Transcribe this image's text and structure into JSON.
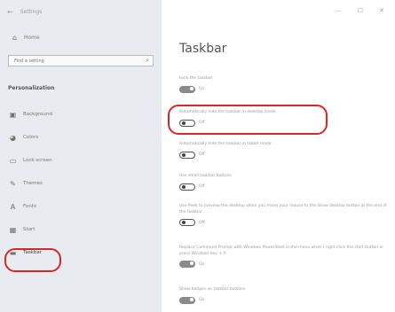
{
  "app": {
    "title": "Settings",
    "back_glyph": "←"
  },
  "sidebar": {
    "home_label": "Home",
    "search_placeholder": "Find a setting",
    "section": "Personalization",
    "items": [
      {
        "label": "Background",
        "icon": "picture-icon"
      },
      {
        "label": "Colors",
        "icon": "palette-icon"
      },
      {
        "label": "Lock screen",
        "icon": "lock-screen-icon"
      },
      {
        "label": "Themes",
        "icon": "brush-icon"
      },
      {
        "label": "Fonts",
        "icon": "font-icon"
      },
      {
        "label": "Start",
        "icon": "start-icon"
      },
      {
        "label": "Taskbar",
        "icon": "taskbar-icon",
        "active": true
      }
    ]
  },
  "window_controls": {
    "minimize": "—",
    "maximize": "☐",
    "close": "✕"
  },
  "main": {
    "title": "Taskbar",
    "settings": [
      {
        "text": "Lock the taskbar",
        "state": "On",
        "on": true
      },
      {
        "text": "Automatically hide the taskbar in desktop mode",
        "state": "Off",
        "on": false
      },
      {
        "text": "Automatically hide the taskbar in tablet mode",
        "state": "Off",
        "on": false
      },
      {
        "text": "Use small taskbar buttons",
        "state": "Off",
        "on": false
      },
      {
        "text": "Use Peek to preview the desktop when you move your mouse to the Show desktop button at the end of the taskbar",
        "state": "Off",
        "on": false
      },
      {
        "text": "Replace Command Prompt with Windows PowerShell in the menu when I right-click the start button or press Windows key + X",
        "state": "On",
        "on": true
      },
      {
        "text": "Show badges on taskbar buttons",
        "state": "On",
        "on": true
      }
    ]
  },
  "colors": {
    "highlight": "#d62828",
    "sidebar_bg": "#e8ebef"
  }
}
